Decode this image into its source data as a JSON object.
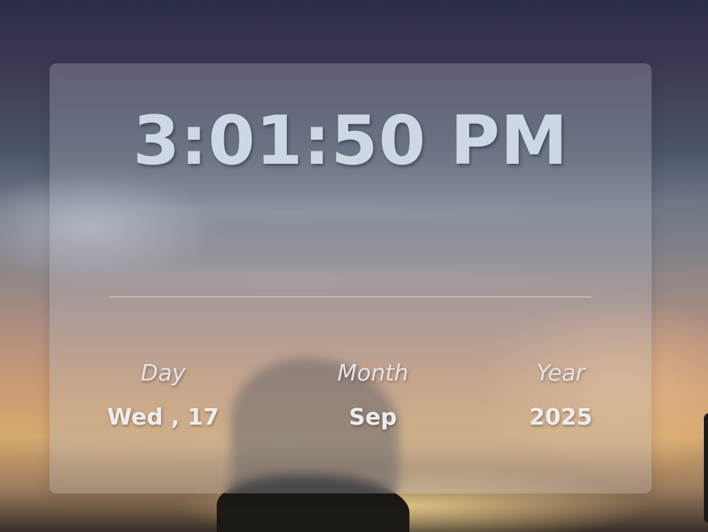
{
  "clock": {
    "time": "3:01:50 PM"
  },
  "date": {
    "day_label": "Day",
    "day_value": "Wed , 17",
    "month_label": "Month",
    "month_value": "Sep",
    "year_label": "Year",
    "year_value": "2025"
  },
  "colors": {
    "time_text": "#cdd8e5",
    "divider": "#e6dcb6",
    "label_text": "#e5e3e6",
    "value_text": "#efecec"
  }
}
